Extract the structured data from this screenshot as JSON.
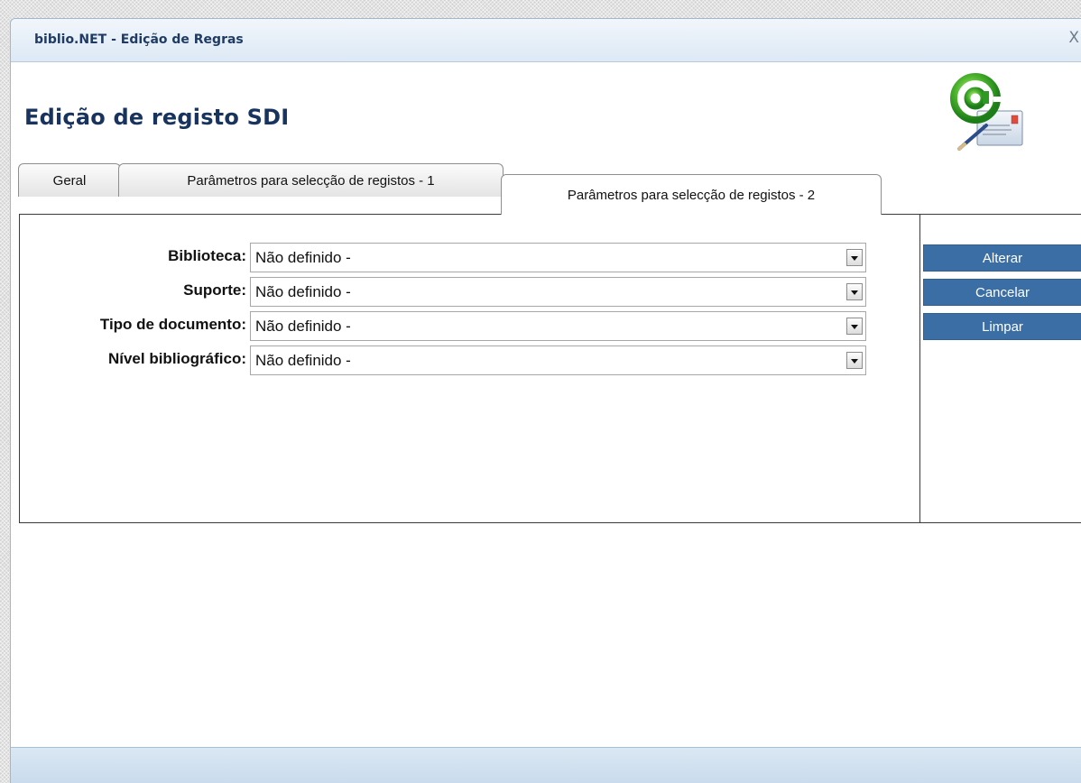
{
  "window": {
    "title": "biblio.NET - Edição de Regras",
    "close_label": "X"
  },
  "page": {
    "title": "Edição de registo SDI",
    "header_icon": "email-at-icon"
  },
  "tabs": [
    {
      "label": "Geral",
      "active": false
    },
    {
      "label": "Parâmetros para selecção de registos - 1",
      "active": false
    },
    {
      "label": "Parâmetros para selecção de registos - 2",
      "active": true
    }
  ],
  "form": {
    "fields": [
      {
        "label": "Biblioteca:",
        "value": "Não definido -"
      },
      {
        "label": "Suporte:",
        "value": "Não definido -"
      },
      {
        "label": "Tipo de documento:",
        "value": "Não definido -"
      },
      {
        "label": "Nível bibliográfico:",
        "value": "Não definido -"
      }
    ]
  },
  "actions": {
    "alterar": "Alterar",
    "cancelar": "Cancelar",
    "limpar": "Limpar"
  },
  "colors": {
    "button_bg": "#3a6ea5",
    "title_color": "#17335e",
    "titlebar_bg": "#dde9f5"
  }
}
